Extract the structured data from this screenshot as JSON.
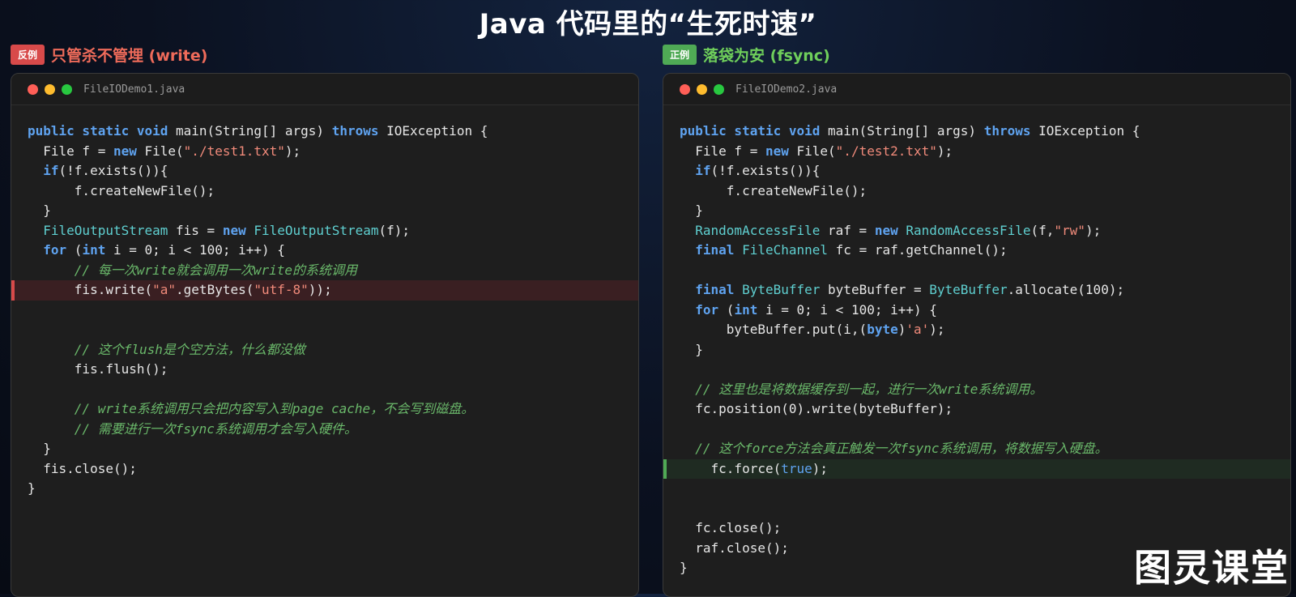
{
  "page": {
    "title": "Java 代码里的“生死时速”",
    "watermark": "图灵课堂"
  },
  "left": {
    "badge": "反例",
    "title": "只管杀不管埋 (write)",
    "filename": "FileIODemo1.java",
    "line_main": {
      "kw1": "public static void",
      "rest": " main(String[] args) ",
      "kw2": "throws",
      "tail": " IOException {"
    },
    "line_file": {
      "pre": "  File f = ",
      "kw": "new",
      "mid": " File(",
      "str": "\"./test1.txt\"",
      "tail": ");"
    },
    "line_if": {
      "kw": "if",
      "tail": "(!f.exists()){"
    },
    "line_create": "      f.createNewFile();",
    "line_close_brace": "  }",
    "line_fos": {
      "type1": "FileOutputStream",
      "mid": " fis = ",
      "kw": "new",
      "type2": " FileOutputStream",
      "tail": "(f);"
    },
    "line_for": {
      "kw1": "for",
      "mid1": " (",
      "kw2": "int",
      "tail": " i = 0; i < 100; i++) {"
    },
    "comment1": "      // 每一次write就会调用一次write的系统调用",
    "line_write": {
      "pre": "      fis.write(",
      "str1": "\"a\"",
      "mid": ".getBytes(",
      "str2": "\"utf-8\"",
      "tail": "));"
    },
    "comment2": "      // 这个flush是个空方法，什么都没做",
    "line_flush": "      fis.flush();",
    "comment3": "      // write系统调用只会把内容写入到page cache，不会写到磁盘。",
    "comment4": "      // 需要进行一次fsync系统调用才会写入硬件。",
    "line_end_for": "  }",
    "line_fis_close": "  fis.close();",
    "line_end": "}"
  },
  "right": {
    "badge": "正例",
    "title": "落袋为安 (fsync)",
    "filename": "FileIODemo2.java",
    "line_main": {
      "kw1": "public static void",
      "rest": " main(String[] args) ",
      "kw2": "throws",
      "tail": " IOException {"
    },
    "line_file": {
      "pre": "  File f = ",
      "kw": "new",
      "mid": " File(",
      "str": "\"./test2.txt\"",
      "tail": ");"
    },
    "line_if": {
      "kw": "if",
      "tail": "(!f.exists()){"
    },
    "line_create": "      f.createNewFile();",
    "line_close_brace": "  }",
    "line_raf": {
      "type1": "RandomAccessFile",
      "mid": " raf = ",
      "kw": "new",
      "type2": " RandomAccessFile",
      "mid2": "(f,",
      "str": "\"rw\"",
      "tail": ");"
    },
    "line_fc": {
      "kw": "final",
      "type": " FileChannel",
      "tail": " fc = raf.getChannel();"
    },
    "line_bb": {
      "kw": "final",
      "type1": " ByteBuffer",
      "mid": " byteBuffer = ",
      "type2": "ByteBuffer",
      "tail": ".allocate(100);"
    },
    "line_for": {
      "kw1": "for",
      "mid1": " (",
      "kw2": "int",
      "tail": " i = 0; i < 100; i++) {"
    },
    "line_put": {
      "pre": "      byteBuffer.put(i,(",
      "kw": "byte",
      "mid": ")",
      "str": "'a'",
      "tail": ");"
    },
    "line_end_for": "  }",
    "comment1": "  // 这里也是将数据缓存到一起，进行一次write系统调用。",
    "line_write": "  fc.position(0).write(byteBuffer);",
    "comment2": "  // 这个force方法会真正触发一次fsync系统调用，将数据写入硬盘。",
    "line_force": {
      "pre": "    fc.force(",
      "lit": "true",
      "tail": ");"
    },
    "line_fc_close": "  fc.close();",
    "line_raf_close": "  raf.close();",
    "line_end": "}"
  }
}
